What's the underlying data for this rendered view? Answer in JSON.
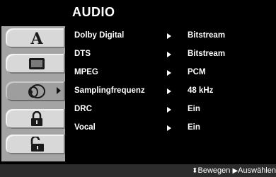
{
  "menu": {
    "title": "AUDIO",
    "tabs": [
      {
        "icon": "letter-a-icon",
        "active": false
      },
      {
        "icon": "tv-screen-icon",
        "active": false
      },
      {
        "icon": "speaker-icon",
        "active": true
      },
      {
        "icon": "padlock-closed-icon",
        "active": false
      },
      {
        "icon": "padlock-open-icon",
        "active": false
      }
    ],
    "tab_a_glyph": "A",
    "rows": [
      {
        "label": "Dolby Digital",
        "value": "Bitstream"
      },
      {
        "label": "DTS",
        "value": "Bitstream"
      },
      {
        "label": "MPEG",
        "value": "PCM"
      },
      {
        "label": "Samplingfrequenz",
        "value": "48 kHz"
      },
      {
        "label": "DRC",
        "value": "Ein"
      },
      {
        "label": "Vocal",
        "value": "Ein"
      }
    ]
  },
  "footer": {
    "move_symbol": "⬍",
    "move_label": "Bewegen",
    "select_symbol": "▶",
    "select_label": "Auswählen"
  },
  "colors": {
    "background": "#000000",
    "frame": "#a4a4a4",
    "tab": "#d8d8d8",
    "tab_active": "#9e9e9e",
    "text": "#ffffff",
    "footer": "#2c2c2c"
  }
}
